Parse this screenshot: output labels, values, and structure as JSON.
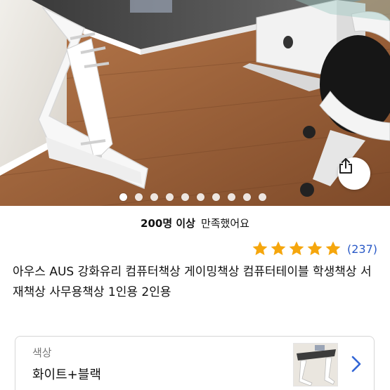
{
  "product": {
    "satisfaction": {
      "count": "200명 이상",
      "text": "만족했어요"
    },
    "rating": {
      "stars": 5,
      "review_count": "(237)",
      "star_color": "#f5a60d"
    },
    "title": "아우스 AUS 강화유리 컴퓨터책상 게이밍책상 컴퓨터테이블 학생책상 서재책상 사무용책상 1인용 2인용"
  },
  "gallery": {
    "image_count": 10,
    "current_index": 1
  },
  "option": {
    "label": "색상",
    "value": "화이트+블랙"
  },
  "icons": {
    "share": "share-icon",
    "chevron": "chevron-right-icon",
    "star": "star-icon"
  },
  "colors": {
    "link_blue": "#2a5ac7",
    "chevron_blue": "#3366d6"
  }
}
